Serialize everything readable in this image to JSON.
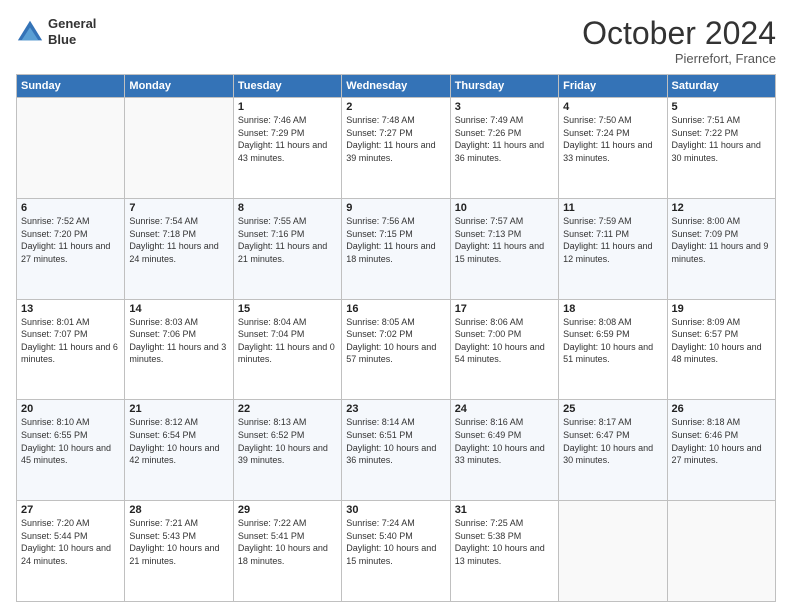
{
  "header": {
    "logo_line1": "General",
    "logo_line2": "Blue",
    "month": "October 2024",
    "location": "Pierrefort, France"
  },
  "weekdays": [
    "Sunday",
    "Monday",
    "Tuesday",
    "Wednesday",
    "Thursday",
    "Friday",
    "Saturday"
  ],
  "weeks": [
    [
      {
        "day": "",
        "info": ""
      },
      {
        "day": "",
        "info": ""
      },
      {
        "day": "1",
        "info": "Sunrise: 7:46 AM\nSunset: 7:29 PM\nDaylight: 11 hours and 43 minutes."
      },
      {
        "day": "2",
        "info": "Sunrise: 7:48 AM\nSunset: 7:27 PM\nDaylight: 11 hours and 39 minutes."
      },
      {
        "day": "3",
        "info": "Sunrise: 7:49 AM\nSunset: 7:26 PM\nDaylight: 11 hours and 36 minutes."
      },
      {
        "day": "4",
        "info": "Sunrise: 7:50 AM\nSunset: 7:24 PM\nDaylight: 11 hours and 33 minutes."
      },
      {
        "day": "5",
        "info": "Sunrise: 7:51 AM\nSunset: 7:22 PM\nDaylight: 11 hours and 30 minutes."
      }
    ],
    [
      {
        "day": "6",
        "info": "Sunrise: 7:52 AM\nSunset: 7:20 PM\nDaylight: 11 hours and 27 minutes."
      },
      {
        "day": "7",
        "info": "Sunrise: 7:54 AM\nSunset: 7:18 PM\nDaylight: 11 hours and 24 minutes."
      },
      {
        "day": "8",
        "info": "Sunrise: 7:55 AM\nSunset: 7:16 PM\nDaylight: 11 hours and 21 minutes."
      },
      {
        "day": "9",
        "info": "Sunrise: 7:56 AM\nSunset: 7:15 PM\nDaylight: 11 hours and 18 minutes."
      },
      {
        "day": "10",
        "info": "Sunrise: 7:57 AM\nSunset: 7:13 PM\nDaylight: 11 hours and 15 minutes."
      },
      {
        "day": "11",
        "info": "Sunrise: 7:59 AM\nSunset: 7:11 PM\nDaylight: 11 hours and 12 minutes."
      },
      {
        "day": "12",
        "info": "Sunrise: 8:00 AM\nSunset: 7:09 PM\nDaylight: 11 hours and 9 minutes."
      }
    ],
    [
      {
        "day": "13",
        "info": "Sunrise: 8:01 AM\nSunset: 7:07 PM\nDaylight: 11 hours and 6 minutes."
      },
      {
        "day": "14",
        "info": "Sunrise: 8:03 AM\nSunset: 7:06 PM\nDaylight: 11 hours and 3 minutes."
      },
      {
        "day": "15",
        "info": "Sunrise: 8:04 AM\nSunset: 7:04 PM\nDaylight: 11 hours and 0 minutes."
      },
      {
        "day": "16",
        "info": "Sunrise: 8:05 AM\nSunset: 7:02 PM\nDaylight: 10 hours and 57 minutes."
      },
      {
        "day": "17",
        "info": "Sunrise: 8:06 AM\nSunset: 7:00 PM\nDaylight: 10 hours and 54 minutes."
      },
      {
        "day": "18",
        "info": "Sunrise: 8:08 AM\nSunset: 6:59 PM\nDaylight: 10 hours and 51 minutes."
      },
      {
        "day": "19",
        "info": "Sunrise: 8:09 AM\nSunset: 6:57 PM\nDaylight: 10 hours and 48 minutes."
      }
    ],
    [
      {
        "day": "20",
        "info": "Sunrise: 8:10 AM\nSunset: 6:55 PM\nDaylight: 10 hours and 45 minutes."
      },
      {
        "day": "21",
        "info": "Sunrise: 8:12 AM\nSunset: 6:54 PM\nDaylight: 10 hours and 42 minutes."
      },
      {
        "day": "22",
        "info": "Sunrise: 8:13 AM\nSunset: 6:52 PM\nDaylight: 10 hours and 39 minutes."
      },
      {
        "day": "23",
        "info": "Sunrise: 8:14 AM\nSunset: 6:51 PM\nDaylight: 10 hours and 36 minutes."
      },
      {
        "day": "24",
        "info": "Sunrise: 8:16 AM\nSunset: 6:49 PM\nDaylight: 10 hours and 33 minutes."
      },
      {
        "day": "25",
        "info": "Sunrise: 8:17 AM\nSunset: 6:47 PM\nDaylight: 10 hours and 30 minutes."
      },
      {
        "day": "26",
        "info": "Sunrise: 8:18 AM\nSunset: 6:46 PM\nDaylight: 10 hours and 27 minutes."
      }
    ],
    [
      {
        "day": "27",
        "info": "Sunrise: 7:20 AM\nSunset: 5:44 PM\nDaylight: 10 hours and 24 minutes."
      },
      {
        "day": "28",
        "info": "Sunrise: 7:21 AM\nSunset: 5:43 PM\nDaylight: 10 hours and 21 minutes."
      },
      {
        "day": "29",
        "info": "Sunrise: 7:22 AM\nSunset: 5:41 PM\nDaylight: 10 hours and 18 minutes."
      },
      {
        "day": "30",
        "info": "Sunrise: 7:24 AM\nSunset: 5:40 PM\nDaylight: 10 hours and 15 minutes."
      },
      {
        "day": "31",
        "info": "Sunrise: 7:25 AM\nSunset: 5:38 PM\nDaylight: 10 hours and 13 minutes."
      },
      {
        "day": "",
        "info": ""
      },
      {
        "day": "",
        "info": ""
      }
    ]
  ]
}
